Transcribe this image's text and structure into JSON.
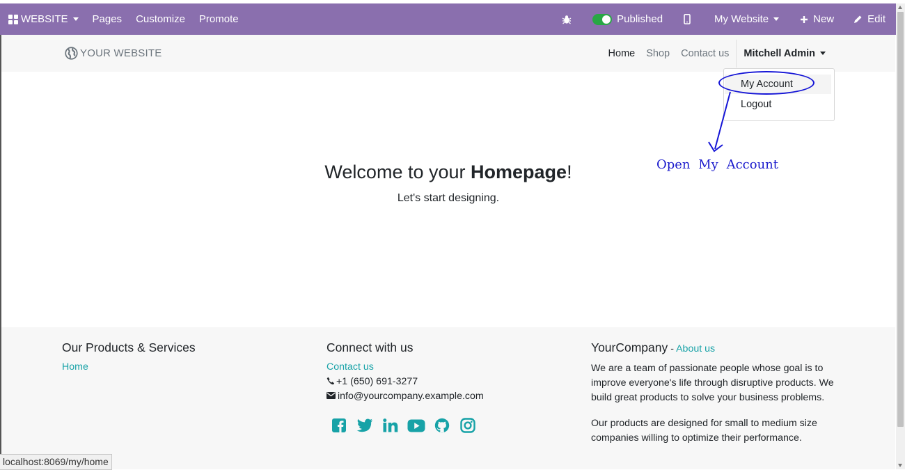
{
  "admin_bar": {
    "app_label": "WEBSITE",
    "menu": [
      "Pages",
      "Customize",
      "Promote"
    ],
    "published_label": "Published",
    "website_switch": "My Website",
    "new_label": "New",
    "edit_label": "Edit"
  },
  "site_header": {
    "logo_text": "YOUR WEBSITE",
    "nav": [
      "Home",
      "Shop",
      "Contact us"
    ],
    "user_name": "Mitchell Admin"
  },
  "user_dropdown": {
    "items": [
      "My Account",
      "Logout"
    ]
  },
  "annotation": {
    "text": "Open My Account",
    "color": "#1515d6"
  },
  "hero": {
    "title_prefix": "Welcome to your ",
    "title_bold": "Homepage",
    "title_suffix": "!",
    "subtitle": "Let's start designing."
  },
  "footer": {
    "col1": {
      "heading": "Our Products & Services",
      "links": [
        "Home"
      ]
    },
    "col2": {
      "heading": "Connect with us",
      "contact_link": "Contact us",
      "phone": "+1 (650) 691-3277",
      "email": "info@yourcompany.example.com",
      "social_icons": [
        "facebook-icon",
        "twitter-icon",
        "linkedin-icon",
        "youtube-icon",
        "github-icon",
        "instagram-icon"
      ]
    },
    "col3": {
      "company": "YourCompany",
      "dash": " - ",
      "about_link": "About us",
      "para1": "We are a team of passionate people whose goal is to improve everyone's life through disruptive products. We build great products to solve your business problems.",
      "para2": "Our products are designed for small to medium size companies willing to optimize their performance."
    }
  },
  "status_bar_url": "localhost:8069/my/home",
  "colors": {
    "admin_bar": "#8a6fae",
    "link_teal": "#17a2a7",
    "toggle_on": "#28a745"
  }
}
